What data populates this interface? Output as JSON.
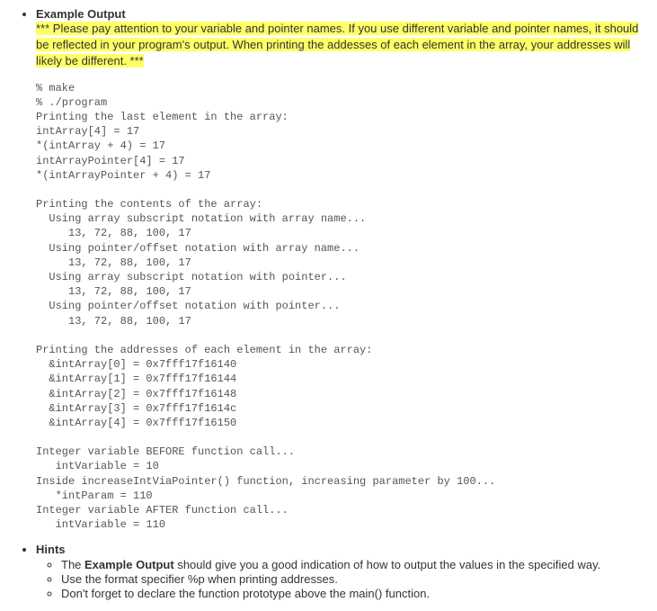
{
  "sections": {
    "example_output_title": "Example Output",
    "warning_text": "*** Please pay attention to your variable and pointer names. If you use different variable and pointer names, it should be reflected in your program's output. When printing the addesses of each element in the array, your addresses will likely be different. ***",
    "code": "% make\n% ./program\nPrinting the last element in the array:\nintArray[4] = 17\n*(intArray + 4) = 17\nintArrayPointer[4] = 17\n*(intArrayPointer + 4) = 17\n\nPrinting the contents of the array:\n  Using array subscript notation with array name...\n     13, 72, 88, 100, 17\n  Using pointer/offset notation with array name...\n     13, 72, 88, 100, 17\n  Using array subscript notation with pointer...\n     13, 72, 88, 100, 17\n  Using pointer/offset notation with pointer...\n     13, 72, 88, 100, 17\n\nPrinting the addresses of each element in the array:\n  &intArray[0] = 0x7fff17f16140\n  &intArray[1] = 0x7fff17f16144\n  &intArray[2] = 0x7fff17f16148\n  &intArray[3] = 0x7fff17f1614c\n  &intArray[4] = 0x7fff17f16150\n\nInteger variable BEFORE function call...\n   intVariable = 10\nInside increaseIntViaPointer() function, increasing parameter by 100...\n   *intParam = 110\nInteger variable AFTER function call...\n   intVariable = 110",
    "hints_title": "Hints",
    "hints": {
      "h1_pre": "The ",
      "h1_bold": "Example Output",
      "h1_post": " should give you a good indication of how to output the values in the specified way.",
      "h2": "Use the format specifier %p when printing addresses.",
      "h3": "Don't forget to declare the function prototype above the main() function."
    }
  }
}
